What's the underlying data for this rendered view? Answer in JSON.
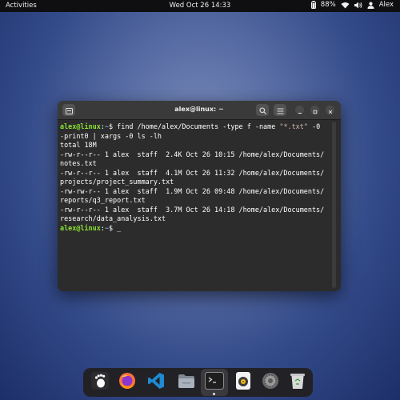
{
  "topbar": {
    "activities": "Activities",
    "clock": "Wed Oct 26  14:33",
    "battery": "88%",
    "user": "Alex"
  },
  "terminal": {
    "title": "alex@linux: ~",
    "lines": [
      [
        {
          "t": "alex@linux",
          "c": "p-user"
        },
        {
          "t": ":"
        },
        {
          "t": "~",
          "c": "p-path"
        },
        {
          "t": "$ find /home/alex/Documents -type f -name "
        },
        {
          "t": "\"*.txt\"",
          "c": "p-str"
        },
        {
          "t": " -0"
        }
      ],
      [
        {
          "t": "-print0 | xargs -0 ls -lh"
        }
      ],
      [
        {
          "t": "total 18M"
        }
      ],
      [
        {
          "t": "-rw-r--r-- 1 alex  staff  2.4K Oct 26 10:15 /home/alex/Documents/"
        }
      ],
      [
        {
          "t": "notes.txt"
        }
      ],
      [
        {
          "t": "-rw-r--r-- 1 alex  staff  4.1M Oct 26 11:32 /home/alex/Documents/"
        }
      ],
      [
        {
          "t": "projects/project_summary.txt"
        }
      ],
      [
        {
          "t": "-rw-rw-r-- 1 alex  staff  1.9M Oct 26 09:48 /home/alex/Documents/"
        }
      ],
      [
        {
          "t": "reports/q3_report.txt"
        }
      ],
      [
        {
          "t": "-rw-r--r-- 1 alex  staff  3.7M Oct 26 14:18 /home/alex/Documents/"
        }
      ],
      [
        {
          "t": "research/data_analysis.txt"
        }
      ],
      [
        {
          "t": "alex@linux",
          "c": "p-user"
        },
        {
          "t": ":"
        },
        {
          "t": "~",
          "c": "p-path"
        },
        {
          "t": "$ _"
        }
      ]
    ]
  },
  "dock": {
    "items": [
      "gnome-foot-icon",
      "firefox-icon",
      "vscode-icon",
      "files-icon",
      "terminal-icon",
      "rhythmbox-icon",
      "settings-icon",
      "trash-icon"
    ],
    "active": "terminal-icon"
  },
  "colors": {
    "prompt_user": "#8ae234",
    "prompt_path": "#729fcf",
    "terminal_bg": "#2c2c2c"
  }
}
